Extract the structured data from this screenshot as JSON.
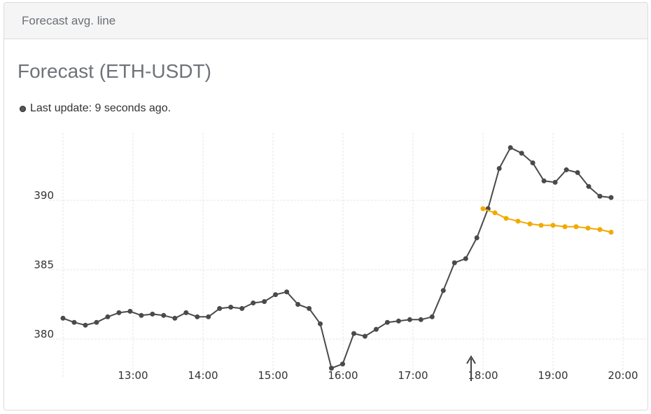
{
  "panel": {
    "header_title": "Forecast avg. line",
    "chart_title": "Forecast (ETH-USDT)",
    "status_text": "Last update: 9 seconds ago."
  },
  "chart_data": {
    "type": "line",
    "title": "Forecast (ETH-USDT)",
    "xlabel": "",
    "ylabel": "",
    "x_ticks": [
      "13:00",
      "14:00",
      "15:00",
      "16:00",
      "17:00",
      "18:00",
      "19:00",
      "20:00"
    ],
    "y_ticks": [
      380,
      385,
      390
    ],
    "xlim_hours": [
      12.0,
      20.0
    ],
    "ylim": [
      377.5,
      394.5
    ],
    "grid": true,
    "now_marker_hours": 17.83,
    "series": [
      {
        "color": "#4a4a4a",
        "x_hours": [
          12.0,
          12.17,
          12.33,
          12.5,
          12.67,
          12.83,
          13.0,
          13.17,
          13.33,
          13.5,
          13.67,
          13.83,
          14.0,
          14.17,
          14.33,
          14.5,
          14.67,
          14.83,
          15.0,
          15.17,
          15.33,
          15.5,
          15.67,
          15.83,
          16.0,
          16.17,
          16.33,
          16.5,
          16.67,
          16.83,
          17.0,
          17.17,
          17.33,
          17.5,
          17.67,
          17.83,
          18.0,
          18.17,
          18.33,
          18.5,
          18.67,
          18.83,
          19.0,
          19.17,
          19.33,
          19.5,
          19.67,
          19.83
        ],
        "values": [
          381.5,
          381.2,
          381.0,
          381.2,
          381.6,
          381.9,
          382.0,
          381.7,
          381.8,
          381.7,
          381.5,
          381.9,
          381.6,
          381.6,
          382.2,
          382.3,
          382.2,
          382.6,
          382.7,
          383.2,
          383.4,
          382.5,
          382.2,
          381.1,
          377.9,
          378.2,
          380.4,
          380.2,
          380.7,
          381.2,
          381.3,
          381.4,
          381.4,
          381.6,
          383.5,
          385.5,
          385.8,
          387.3,
          389.4,
          392.3,
          393.8,
          393.4,
          392.7,
          391.4,
          391.3,
          392.2,
          392.0,
          391.0,
          390.3,
          390.2
        ]
      },
      {
        "color": "#f2a900",
        "x_hours": [
          18.0,
          18.17,
          18.33,
          18.5,
          18.67,
          18.83,
          19.0,
          19.17,
          19.33,
          19.5,
          19.67,
          19.83
        ],
        "values": [
          389.4,
          389.1,
          388.7,
          388.5,
          388.3,
          388.2,
          388.2,
          388.1,
          388.1,
          388.0,
          387.9,
          387.7
        ]
      }
    ]
  }
}
